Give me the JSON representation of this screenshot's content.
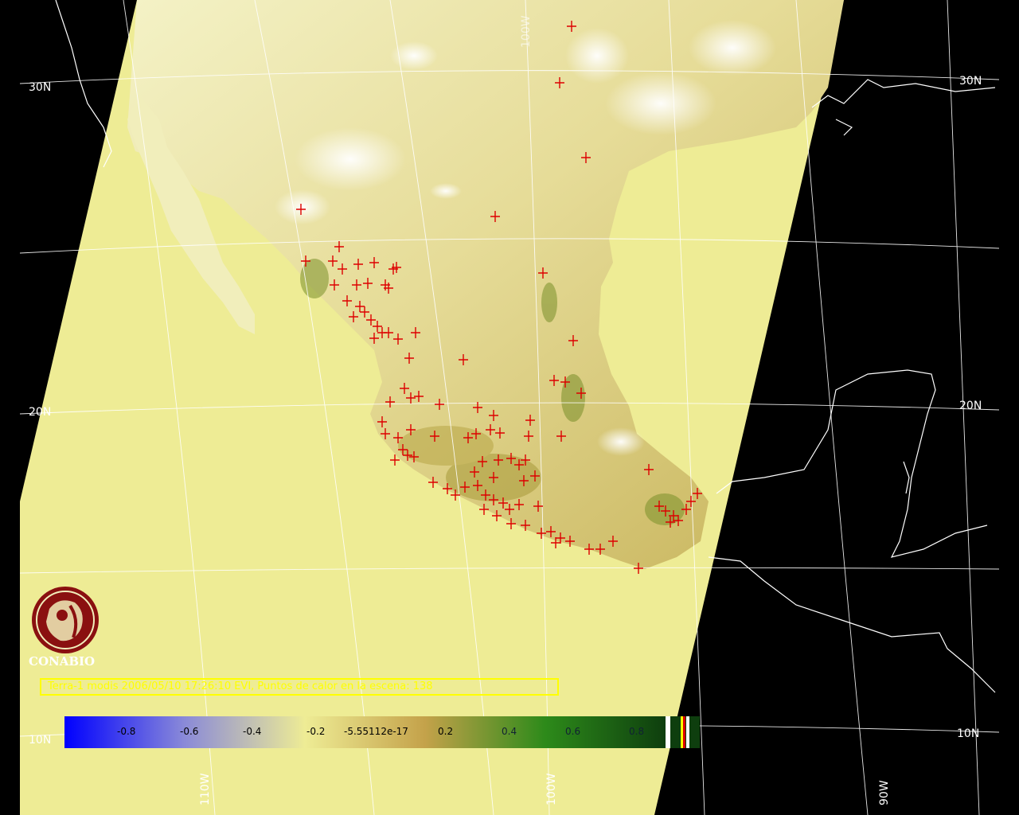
{
  "map": {
    "grid_labels": {
      "lat_30n_left": "30N",
      "lat_30n_right": "30N",
      "lat_20n_left": "20N",
      "lat_20n_right": "20N",
      "lat_10n_left": "10N",
      "lat_10n_right": "10N",
      "lon_110w": "110W",
      "lon_100w": "100W",
      "lon_90w": "90W",
      "lon_100w_top": "100W"
    },
    "colors": {
      "background": "#000000",
      "swath": "#eeec95",
      "grid": "#ffffff",
      "coastline": "#ffffff",
      "hotspot": "#dd0000",
      "caption": "#ffff00"
    },
    "hotspot_marker": "plus-cross",
    "hotspot_count_caption": "138"
  },
  "logo": {
    "name": "CONABIO"
  },
  "caption": {
    "text": "Terra-1 modis 2006/05/10 17:26:10 EVI, Puntos de calor en la escena: 138"
  },
  "colorbar": {
    "ticks": [
      "-0.8",
      "-0.6",
      "-0.4",
      "-0.2",
      "-5.55112e-17",
      "0.2",
      "0.4",
      "0.6",
      "0.8"
    ],
    "gradient": [
      "#0000ff",
      "#8a8ad8",
      "#eeec95",
      "#c4a24a",
      "#2d8a1a",
      "#0e3e0e"
    ],
    "range": [
      -1,
      1
    ]
  }
}
